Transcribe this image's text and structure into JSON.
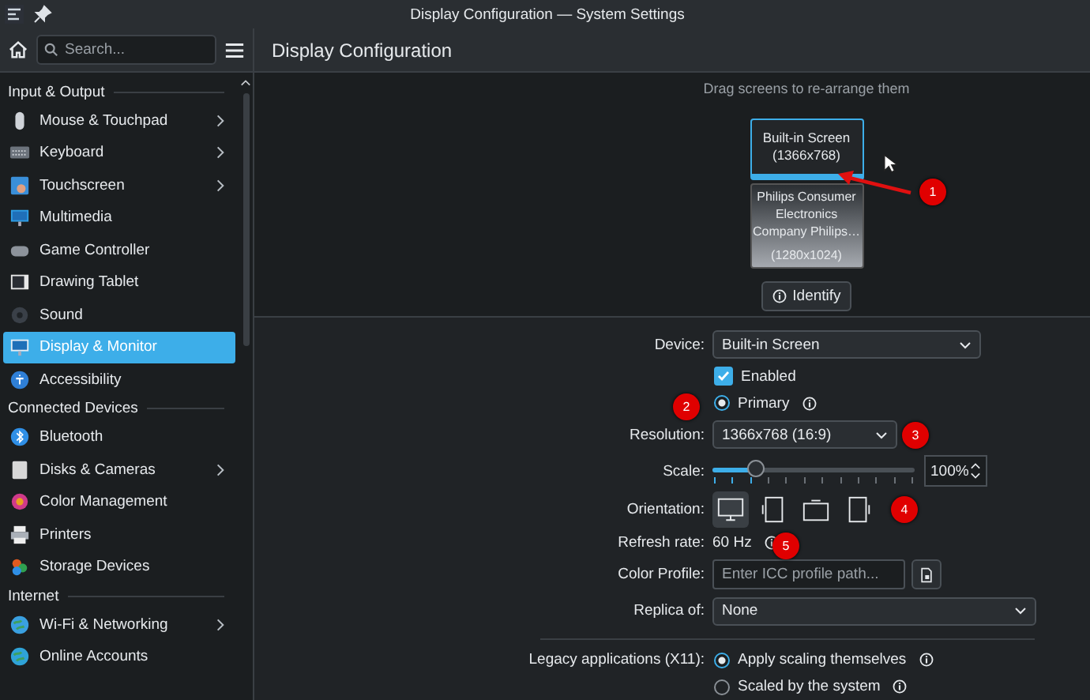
{
  "window": {
    "title": "Display Configuration — System Settings"
  },
  "search": {
    "placeholder": "Search..."
  },
  "sidebar": {
    "sections": [
      {
        "heading": "Input & Output",
        "items": [
          {
            "label": "Mouse & Touchpad",
            "expandable": true,
            "selected": false
          },
          {
            "label": "Keyboard",
            "expandable": true,
            "selected": false
          },
          {
            "label": "Touchscreen",
            "expandable": true,
            "selected": false
          },
          {
            "label": "Multimedia",
            "expandable": false,
            "selected": false
          },
          {
            "label": "Game Controller",
            "expandable": false,
            "selected": false
          },
          {
            "label": "Drawing Tablet",
            "expandable": false,
            "selected": false
          },
          {
            "label": "Sound",
            "expandable": false,
            "selected": false
          },
          {
            "label": "Display & Monitor",
            "expandable": false,
            "selected": true
          },
          {
            "label": "Accessibility",
            "expandable": false,
            "selected": false
          }
        ]
      },
      {
        "heading": "Connected Devices",
        "items": [
          {
            "label": "Bluetooth",
            "expandable": false,
            "selected": false
          },
          {
            "label": "Disks & Cameras",
            "expandable": true,
            "selected": false
          },
          {
            "label": "Color Management",
            "expandable": false,
            "selected": false
          },
          {
            "label": "Printers",
            "expandable": false,
            "selected": false
          },
          {
            "label": "Storage Devices",
            "expandable": false,
            "selected": false
          }
        ]
      },
      {
        "heading": "Internet",
        "items": [
          {
            "label": "Wi-Fi & Networking",
            "expandable": true,
            "selected": false
          },
          {
            "label": "Online Accounts",
            "expandable": false,
            "selected": false
          }
        ]
      }
    ]
  },
  "page": {
    "title": "Display Configuration"
  },
  "arrangement": {
    "hint": "Drag screens to re-arrange them",
    "screens": [
      {
        "lines": [
          "Built-in Screen",
          "(1366x768)"
        ],
        "selected": true
      },
      {
        "lines": [
          "Philips Consumer",
          "Electronics",
          "Company Philips…",
          "(1280x1024)"
        ],
        "selected": false
      }
    ],
    "identify_button": "Identify"
  },
  "form": {
    "device": {
      "label": "Device:",
      "value": "Built-in Screen"
    },
    "enabled": {
      "label": "Enabled",
      "checked": true
    },
    "primary": {
      "label": "Primary",
      "selected": true
    },
    "resolution": {
      "label": "Resolution:",
      "value": "1366x768 (16:9)"
    },
    "scale": {
      "label": "Scale:",
      "level": 0.22,
      "value": "100%"
    },
    "orientation": {
      "label": "Orientation:",
      "options": [
        {
          "kind": "normal",
          "selected": true
        },
        {
          "kind": "left",
          "selected": false
        },
        {
          "kind": "inverted",
          "selected": false
        },
        {
          "kind": "right",
          "selected": false
        }
      ]
    },
    "refresh_rate": {
      "label": "Refresh rate:",
      "value": "60 Hz"
    },
    "color_profile": {
      "label": "Color Profile:",
      "placeholder": "Enter ICC profile path..."
    },
    "replica": {
      "label": "Replica of:",
      "value": "None"
    },
    "legacy": {
      "label": "Legacy applications (X11):",
      "options": [
        {
          "label": "Apply scaling themselves",
          "selected": true
        },
        {
          "label": "Scaled by the system",
          "selected": false
        }
      ]
    }
  },
  "annotations": [
    "1",
    "2",
    "3",
    "4",
    "5"
  ]
}
